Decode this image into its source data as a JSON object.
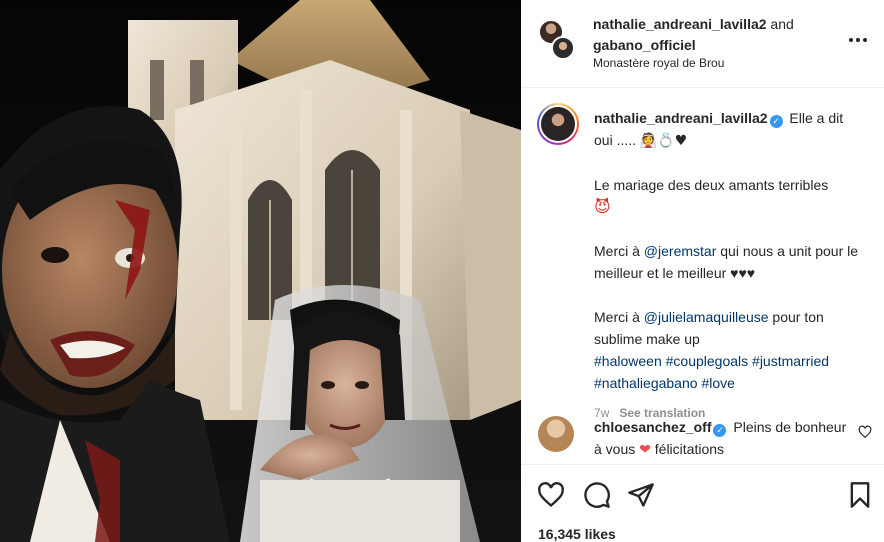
{
  "header": {
    "user1": "nathalie_andreani_lavilla2",
    "connector": " and",
    "user2": "gabano_officiel",
    "location": "Monastère royal de Brou",
    "more_icon": "more-horizontal-icon"
  },
  "caption": {
    "username": "nathalie_andreani_lavilla2",
    "line1_text": "Elle a dit oui ..... ",
    "line1_emoji": "👰💍♥",
    "para2": "Le mariage des deux amants terribles",
    "para2_emoji": "😈",
    "para3_a": "Merci à ",
    "para3_mention": "@jeremstar",
    "para3_b": " qui nous a unit pour le meilleur et le meilleur ♥♥♥",
    "para4_a": "Merci à ",
    "para4_mention": "@julielamaquilleuse",
    "para4_b": " pour ton sublime make up",
    "hashtags": [
      "#haloween",
      "#couplegoals",
      "#justmarried",
      "#nathaliegabano",
      "#love"
    ],
    "time": "7w",
    "see_translation": "See translation"
  },
  "comment": {
    "username": "chloesanchez_off",
    "text_a": "Pleins de bonheur à vous ",
    "heart": "❤",
    "text_b": " félicitations"
  },
  "stats": {
    "likes": "16,345 likes"
  },
  "colors": {
    "link": "#00376b",
    "verified": "#3897f0",
    "muted": "#8e8e8e",
    "heart": "#ed4956"
  }
}
